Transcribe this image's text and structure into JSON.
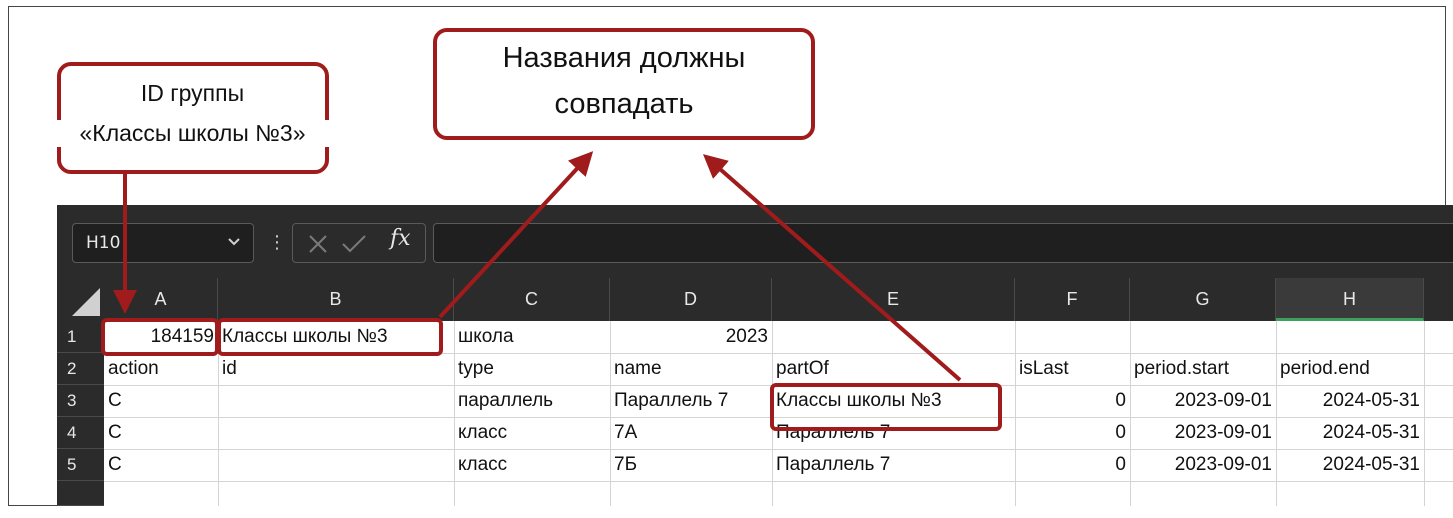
{
  "callouts": {
    "group_id": {
      "line1": "ID группы",
      "line2": "«Классы школы №3»"
    },
    "names_match": {
      "line1": "Названия должны",
      "line2": "совпадать"
    }
  },
  "toolbar": {
    "name_box": "H10",
    "fx": "fx"
  },
  "columns": [
    "A",
    "B",
    "C",
    "D",
    "E",
    "F",
    "G",
    "H"
  ],
  "selected_column": "H",
  "rows": [
    "1",
    "2",
    "3",
    "4",
    "5"
  ],
  "cells": {
    "r1": {
      "A": "184159",
      "B": "Классы школы №3",
      "C": "школа",
      "D": "2023"
    },
    "r2": {
      "A": "action",
      "B": "id",
      "C": "type",
      "D": "name",
      "E": "partOf",
      "F": "isLast",
      "G": "period.start",
      "H": "period.end"
    },
    "r3": {
      "A": "C",
      "C": "параллель",
      "D": "Параллель 7",
      "E": "Классы школы №3",
      "F": "0",
      "G": "2023-09-01",
      "H": "2024-05-31"
    },
    "r4": {
      "A": "C",
      "C": "класс",
      "D": "7А",
      "E": "Параллель 7",
      "F": "0",
      "G": "2023-09-01",
      "H": "2024-05-31"
    },
    "r5": {
      "A": "C",
      "C": "класс",
      "D": "7Б",
      "E": "Параллель 7",
      "F": "0",
      "G": "2023-09-01",
      "H": "2024-05-31"
    }
  },
  "colors": {
    "annotation": "#a01b1b",
    "selected_header_accent": "#3aa05c",
    "toolbar_bg": "#2b2b2b"
  }
}
